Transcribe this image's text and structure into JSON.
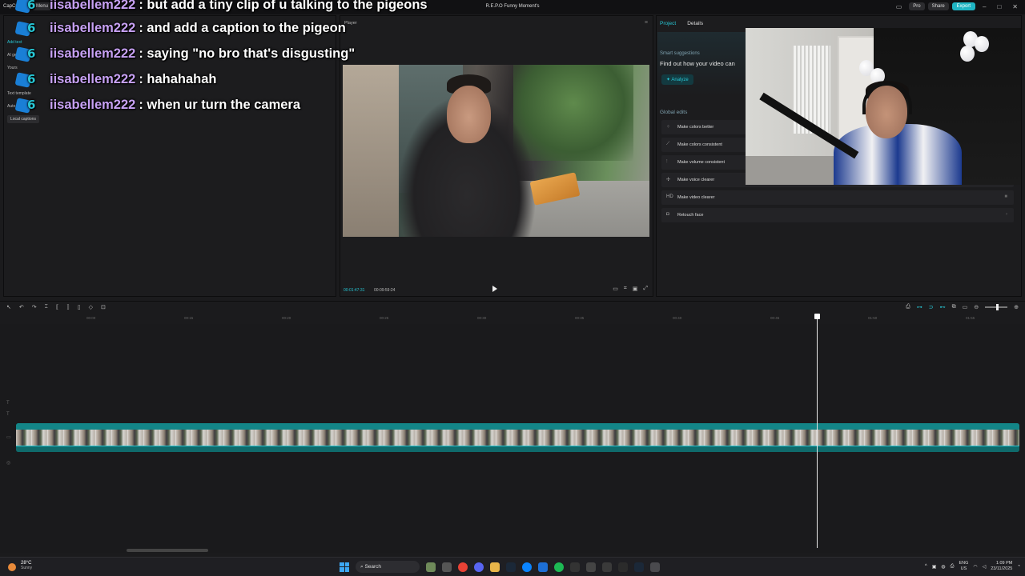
{
  "titlebar": {
    "app_name": "CapCut",
    "menu_label": "Menu",
    "autosave": "Auto saved: 13:09:23",
    "project_title": "R.E.P.O Funny Moment's",
    "pro_label": "Pro",
    "share_label": "Share",
    "export_label": "Export"
  },
  "left_panel": {
    "items": [
      "Add text",
      "AI gen",
      "Yours",
      "Text template",
      "Auto captions"
    ],
    "local_captions": "Local captions"
  },
  "chat": {
    "badge_text": "6",
    "messages": [
      {
        "user": "iisabellem222",
        "text": ": but add a tiny clip of u talking to the pigeons"
      },
      {
        "user": "iisabellem222",
        "text": ": and add a caption to the pigeon"
      },
      {
        "user": "iisabellem222",
        "text": ": saying \"no bro that's disgusting\""
      },
      {
        "user": "iisabellem222",
        "text": ": hahahahah"
      },
      {
        "user": "iisabellem222",
        "text": ": when ur turn the camera"
      }
    ]
  },
  "player": {
    "label": "Player",
    "current_time": "00:01:47:31",
    "total_time": "00:09:59:24"
  },
  "right_panel": {
    "tabs": [
      "Project",
      "Details"
    ],
    "suggestions_heading": "Smart suggestions",
    "suggestions_sub": "Find out how your video can",
    "analyze_label": "Analyze",
    "global_heading": "Global edits",
    "global_edits": [
      {
        "label": "Make colors better"
      },
      {
        "label": "Make colors consistent"
      },
      {
        "label": "Make volume consistent"
      },
      {
        "label": "Make voice clearer"
      },
      {
        "label": "Make video clearer"
      },
      {
        "label": "Retouch face"
      }
    ]
  },
  "timeline": {
    "ruler_marks": [
      "00:00",
      "00:15",
      "00:20",
      "00:25",
      "00:30",
      "00:35",
      "00:40",
      "00:45",
      "01:50",
      "01:55"
    ]
  },
  "taskbar": {
    "temperature": "28°C",
    "condition": "Sunny",
    "search_label": "Search",
    "lang_line1": "ENG",
    "lang_line2": "US",
    "time": "1:09 PM",
    "date": "23/11/2025"
  },
  "colors": {
    "accent": "#27c6d4",
    "chat_username": "#c7a1f4",
    "clip": "#0f6a6b"
  }
}
